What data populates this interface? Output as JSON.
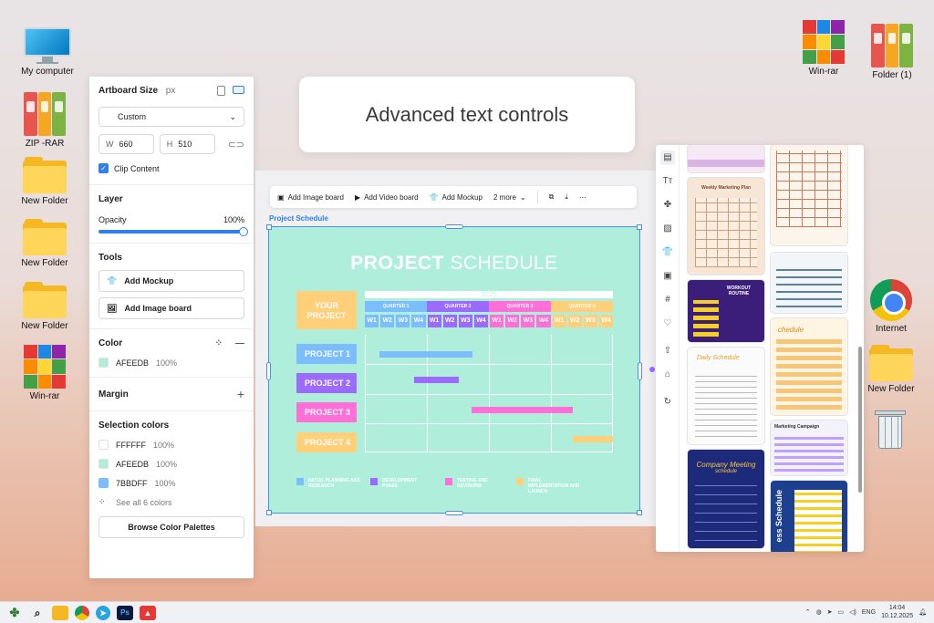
{
  "desktop": {
    "left_icons": [
      "My computer",
      "ZIP -RAR",
      "New Folder",
      "New Folder",
      "New Folder",
      "Win-rar"
    ],
    "right_icons": [
      "Win-rar",
      "Folder (1)",
      "Internet",
      "New Folder"
    ]
  },
  "banner": {
    "text": "Advanced text controls"
  },
  "left_panel": {
    "artboard_title": "Artboard Size",
    "unit": "px",
    "size_select": "Custom",
    "width_label": "W",
    "width_value": "660",
    "height_label": "H",
    "height_value": "510",
    "clip_content": "Clip Content",
    "layer_title": "Layer",
    "opacity_label": "Opacity",
    "opacity_value": "100%",
    "tools_title": "Tools",
    "tool_mockup": "Add Mockup",
    "tool_imageboard": "Add Image board",
    "color_title": "Color",
    "color_hex": "AFEEDB",
    "color_opacity": "100%",
    "margin_title": "Margin",
    "selection_title": "Selection colors",
    "selection_colors": [
      {
        "hex": "FFFFFF",
        "opacity": "100%",
        "color": "#FFFFFF"
      },
      {
        "hex": "AFEEDB",
        "opacity": "100%",
        "color": "#AFEEDB"
      },
      {
        "hex": "7BBDFF",
        "opacity": "100%",
        "color": "#7BBDFF"
      }
    ],
    "see_all": "See all 6 colors",
    "browse_btn": "Browse Color Palettes"
  },
  "toolbar": {
    "add_image_board": "Add Image board",
    "add_video_board": "Add Video board",
    "add_mockup": "Add Mockup",
    "more": "2 more"
  },
  "artboard": {
    "label": "Project Schedule",
    "title_bold": "PROJECT",
    "title_light": " SCHEDULE",
    "your_project": "YOUR PROJECT",
    "year": "2025",
    "quarters": [
      "QUARTER 1",
      "QUARTER 2",
      "QUARTER 3",
      "QUARTER 4"
    ],
    "weeks": [
      "W1",
      "W2",
      "W3",
      "W4",
      "W1",
      "W2",
      "W3",
      "W4",
      "W1",
      "W2",
      "W3",
      "W4",
      "W1",
      "W2",
      "W3",
      "W4"
    ],
    "projects": [
      "PROJECT 1",
      "PROJECT 2",
      "PROJECT 3",
      "PROJECT 4"
    ],
    "legend": [
      "INITIAL PLANNING AND RESEARCH",
      "DEVELOPMENT PHASE",
      "TESTING AND REVISIONS",
      "FINAL IMPLEMENTATION AND LAUNCH"
    ],
    "colors": {
      "bg": "#AFEEDB",
      "blue": "#7BBDFF",
      "purple": "#9B6BFF",
      "pink": "#FF6FD8",
      "orange": "#FFCF7A"
    }
  },
  "templates": {
    "weekly_marketing_plan": "Weekly Marketing Plan",
    "workout_routine": "WORKOUT ROUTINE",
    "schedule": "chedule",
    "daily_schedule": "Daily Schedule",
    "marketing_campaign": "Marketing Campaign",
    "company_meeting": "Company Meeting",
    "company_meeting_sub": "schedule",
    "business_schedule": "ess Schedule"
  },
  "taskbar": {
    "lang": "ENG",
    "time": "14:04",
    "date": "10.12.2025"
  }
}
